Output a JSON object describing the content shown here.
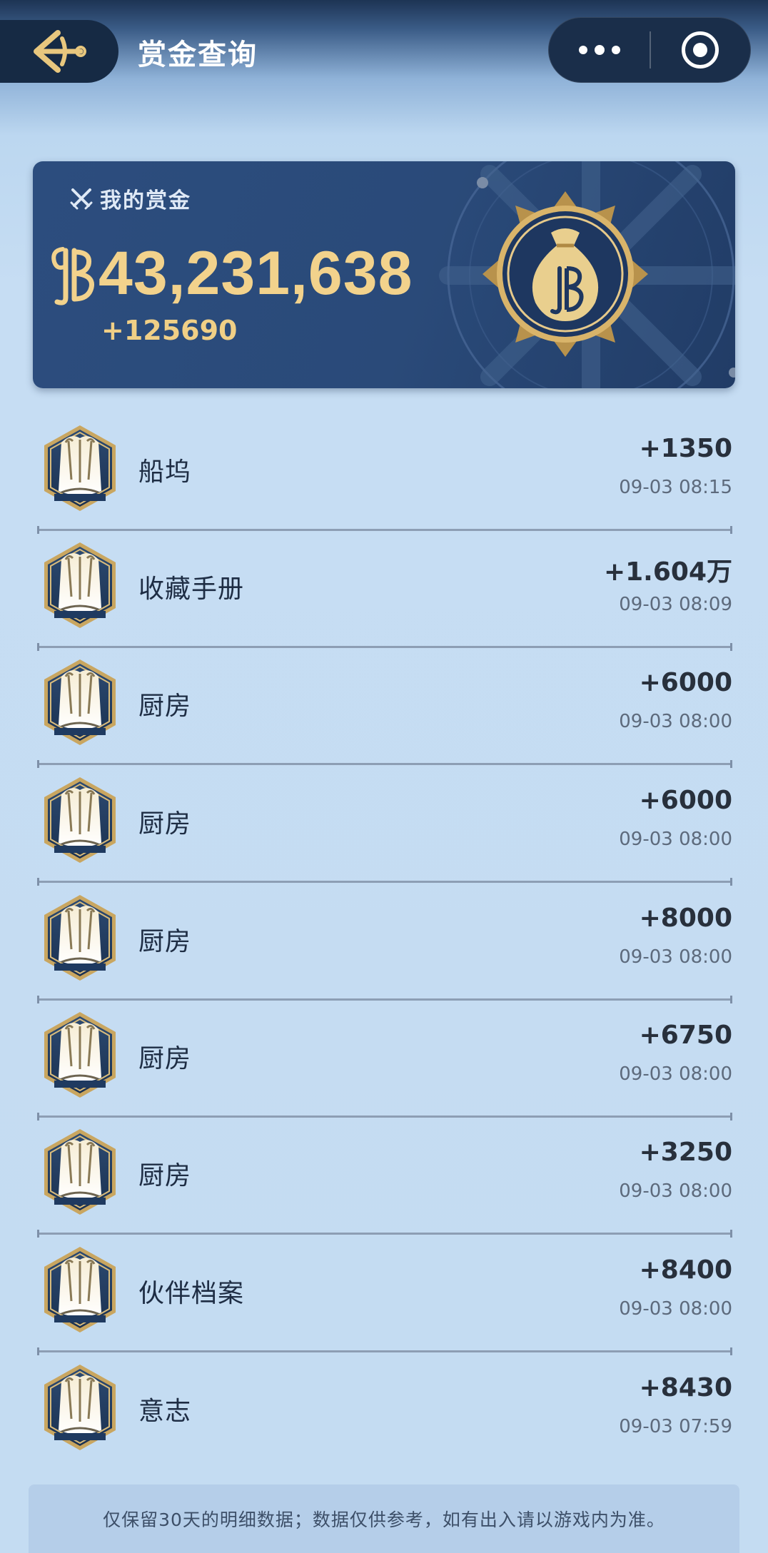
{
  "nav": {
    "title": "赏金查询",
    "back_icon": "anchor-back-icon",
    "more_icon": "more-dots-icon",
    "close_icon": "target-close-icon"
  },
  "bounty": {
    "label": "我的赏金",
    "amount": "43,231,638",
    "delta": "+125690",
    "label_icon": "crossed-swords-icon",
    "currency_icon": "berry-currency-icon",
    "medal_icon": "money-bag-medal-icon"
  },
  "records": [
    {
      "name": "船坞",
      "amount": "+1350",
      "time": "09-03 08:15"
    },
    {
      "name": "收藏手册",
      "amount": "+1.604万",
      "time": "09-03 08:09"
    },
    {
      "name": "厨房",
      "amount": "+6000",
      "time": "09-03 08:00"
    },
    {
      "name": "厨房",
      "amount": "+6000",
      "time": "09-03 08:00"
    },
    {
      "name": "厨房",
      "amount": "+8000",
      "time": "09-03 08:00"
    },
    {
      "name": "厨房",
      "amount": "+6750",
      "time": "09-03 08:00"
    },
    {
      "name": "厨房",
      "amount": "+3250",
      "time": "09-03 08:00"
    },
    {
      "name": "伙伴档案",
      "amount": "+8400",
      "time": "09-03 08:00"
    },
    {
      "name": "意志",
      "amount": "+8430",
      "time": "09-03 07:59"
    }
  ],
  "footer": {
    "note": "仅保留30天的明细数据；数据仅供参考，如有出入请以游戏内为准。"
  },
  "colors": {
    "card_bg": "#2c4d7e",
    "gold": "#f2d28c",
    "nav_bg": "#162a44",
    "page_bg": "#c4dcf2"
  }
}
